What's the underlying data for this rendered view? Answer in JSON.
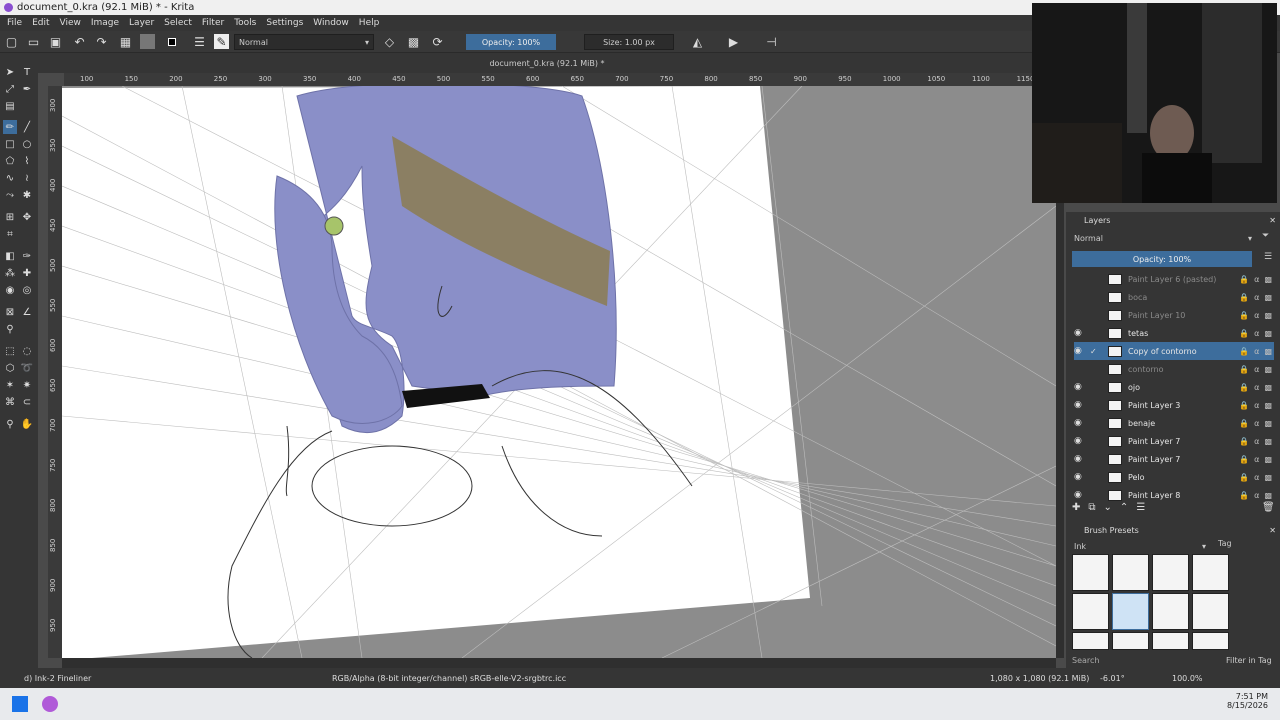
{
  "window": {
    "title": "document_0.kra (92.1 MiB) * - Krita"
  },
  "menu": [
    "File",
    "Edit",
    "View",
    "Image",
    "Layer",
    "Select",
    "Filter",
    "Tools",
    "Settings",
    "Window",
    "Help"
  ],
  "toolbar": {
    "blend_mode": "Normal",
    "opacity_label": "Opacity: 100%",
    "size_label": "Size: 1.00 px"
  },
  "document_tab": "document_0.kra (92.1 MiB) *",
  "ruler": {
    "h_ticks": [
      "100",
      "150",
      "200",
      "250",
      "300",
      "350",
      "400",
      "450",
      "500",
      "550",
      "600",
      "650",
      "700",
      "750",
      "800",
      "850",
      "900",
      "950",
      "1000",
      "1050",
      "1100",
      "1150"
    ],
    "v_ticks": [
      "300",
      "350",
      "400",
      "450",
      "500",
      "550",
      "600",
      "650",
      "700",
      "750",
      "800",
      "850",
      "900",
      "950"
    ]
  },
  "layers_panel": {
    "title": "Layers",
    "blend_mode": "Normal",
    "opacity_label": "Opacity: 100%",
    "layers": [
      {
        "name": "Paint Layer 6 (pasted)",
        "visible": false
      },
      {
        "name": "boca",
        "visible": false
      },
      {
        "name": "Paint Layer 10",
        "visible": false
      },
      {
        "name": "tetas",
        "visible": true
      },
      {
        "name": "Copy of contorno",
        "visible": true,
        "selected": true
      },
      {
        "name": "contorno",
        "visible": false
      },
      {
        "name": "ojo",
        "visible": true
      },
      {
        "name": "Paint Layer 3",
        "visible": true
      },
      {
        "name": "benaje",
        "visible": true
      },
      {
        "name": "Paint Layer 7",
        "visible": true
      },
      {
        "name": "Paint Layer 7",
        "visible": true
      },
      {
        "name": "Pelo",
        "visible": true
      },
      {
        "name": "Paint Layer 8",
        "visible": true
      }
    ]
  },
  "brush_presets": {
    "title": "Brush Presets",
    "tag": "Ink",
    "tag_button": "Tag",
    "search_placeholder": "Search",
    "filter_label": "Filter in Tag"
  },
  "status": {
    "brush": "d) Ink-2 Fineliner",
    "color_space": "RGB/Alpha (8-bit integer/channel)  sRGB-elle-V2-srgbtrc.icc",
    "image_size": "1,080 x 1,080 (92.1 MiB)",
    "rotation": "-6.01°",
    "zoom": "100.0%"
  },
  "taskbar": {
    "time": "7:51 PM",
    "date": "8/15/2026"
  },
  "colors": {
    "accent": "#3d6d9c",
    "hair": "#8a8fc8",
    "band": "#8b7e5a"
  }
}
